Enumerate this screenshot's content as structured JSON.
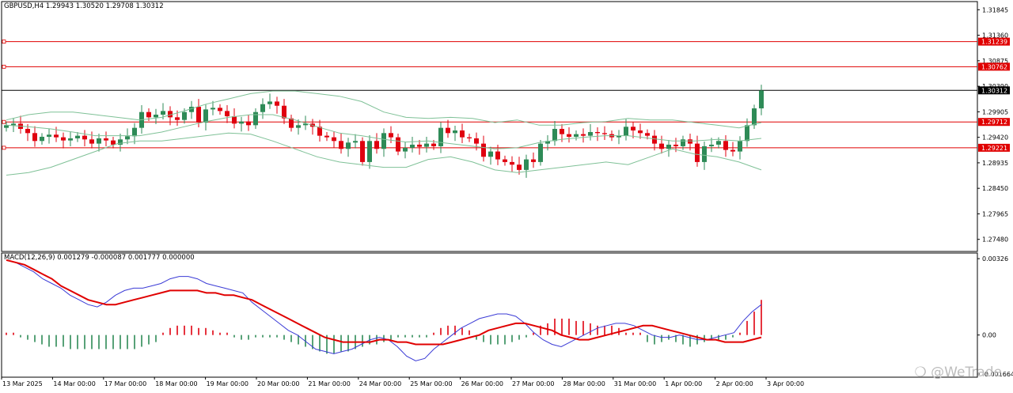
{
  "header": {
    "main_info": "GBPUSD,H4  1.29943 1.30520 1.29708 1.30312",
    "macd_info": "MACD(12,26,9) 0.001279 -0.000087 0.001777 0.000000"
  },
  "watermark": "@WeTrade",
  "colors": {
    "background": "#ffffff",
    "bull": "#2e8b57",
    "bear": "#e0000f",
    "band": "#7fc197",
    "hline": "#e00000",
    "macd_line": "#3b3bd6",
    "signal_line": "#e00000",
    "grid_border": "#000000"
  },
  "chart_data": [
    {
      "type": "candlestick",
      "symbol": "GBPUSD",
      "timeframe": "H4",
      "last_ohlc": {
        "open": 1.29943,
        "high": 1.3052,
        "low": 1.29708,
        "close": 1.30312
      },
      "price_axis_ticks": [
        "1.31845",
        "1.31360",
        "1.30875",
        "1.30390",
        "1.29905",
        "1.29420",
        "1.28935",
        "1.28450",
        "1.27965",
        "1.27480"
      ],
      "y_range": [
        1.2725,
        1.32
      ],
      "time_labels": [
        "13 Mar 2025",
        "14 Mar 00:00",
        "17 Mar 00:00",
        "18 Mar 00:00",
        "19 Mar 00:00",
        "20 Mar 00:00",
        "21 Mar 00:00",
        "24 Mar 00:00",
        "25 Mar 00:00",
        "26 Mar 00:00",
        "27 Mar 00:00",
        "28 Mar 00:00",
        "31 Mar 00:00",
        "1 Apr 00:00",
        "2 Apr 00:00",
        "3 Apr 00:00"
      ],
      "horizontal_levels": [
        {
          "value": 1.31239,
          "label": "1.31239",
          "color": "#e00000"
        },
        {
          "value": 1.30762,
          "label": "1.30762",
          "color": "#e00000"
        },
        {
          "value": 1.30312,
          "label": "1.30312",
          "color": "#000000"
        },
        {
          "value": 1.29712,
          "label": "1.29712",
          "color": "#e00000"
        },
        {
          "value": 1.29221,
          "label": "1.29221",
          "color": "#e00000"
        }
      ],
      "closes": [
        1.2965,
        1.2968,
        1.2958,
        1.295,
        1.2935,
        1.2943,
        1.2947,
        1.2942,
        1.2936,
        1.294,
        1.2945,
        1.2938,
        1.293,
        1.294,
        1.2936,
        1.2928,
        1.2938,
        1.2944,
        1.296,
        1.299,
        1.298,
        1.2985,
        1.2992,
        1.298,
        1.2975,
        1.299,
        1.3,
        1.297,
        1.2995,
        1.2998,
        1.2992,
        1.2982,
        1.2968,
        1.2972,
        1.2965,
        1.299,
        1.3005,
        1.301,
        1.3002,
        1.2978,
        1.296,
        1.2965,
        1.2968,
        1.2962,
        1.2945,
        1.2942,
        1.2935,
        1.292,
        1.2932,
        1.2935,
        1.2895,
        1.2935,
        1.292,
        1.295,
        1.2942,
        1.2915,
        1.2922,
        1.2928,
        1.2924,
        1.293,
        1.2925,
        1.296,
        1.295,
        1.2955,
        1.2942,
        1.294,
        1.293,
        1.2905,
        1.2915,
        1.29,
        1.2895,
        1.289,
        1.288,
        1.29,
        1.2895,
        1.293,
        1.2935,
        1.2958,
        1.2948,
        1.2943,
        1.2948,
        1.2945,
        1.2952,
        1.295,
        1.2948,
        1.2942,
        1.2945,
        1.2962,
        1.2955,
        1.295,
        1.2945,
        1.293,
        1.292,
        1.2928,
        1.2925,
        1.2938,
        1.293,
        1.2895,
        1.2925,
        1.2928,
        1.2935,
        1.2918,
        1.2915,
        1.2935,
        1.2965,
        1.2997,
        1.3031
      ],
      "bollinger_bands": {
        "upper": [
          1.2975,
          1.2985,
          1.299,
          1.299,
          1.2985,
          1.298,
          1.2975,
          1.298,
          1.2992,
          1.3005,
          1.3015,
          1.3025,
          1.303,
          1.303,
          1.3025,
          1.302,
          1.301,
          1.299,
          1.298,
          1.2978,
          1.298,
          1.2978,
          1.297,
          1.2975,
          1.2965,
          1.2965,
          1.297,
          1.2972,
          1.2978,
          1.2975,
          1.2975,
          1.297,
          1.2965,
          1.296,
          1.297
        ],
        "middle": [
          1.2965,
          1.2962,
          1.2958,
          1.2952,
          1.2945,
          1.2945,
          1.2945,
          1.2952,
          1.2962,
          1.2972,
          1.298,
          1.2985,
          1.2985,
          1.2975,
          1.2962,
          1.295,
          1.2945,
          1.2938,
          1.2933,
          1.2935,
          1.293,
          1.2925,
          1.292,
          1.2922,
          1.2932,
          1.2938,
          1.2942,
          1.2945,
          1.2945,
          1.294,
          1.2935,
          1.2935,
          1.2938,
          1.2935,
          1.294
        ],
        "lower": [
          1.287,
          1.2875,
          1.2885,
          1.29,
          1.2915,
          1.293,
          1.2935,
          1.2935,
          1.294,
          1.2945,
          1.295,
          1.2948,
          1.2935,
          1.292,
          1.2905,
          1.2895,
          1.289,
          1.2885,
          1.2885,
          1.29,
          1.2905,
          1.2895,
          1.288,
          1.2875,
          1.288,
          1.2885,
          1.289,
          1.2895,
          1.289,
          1.2905,
          1.292,
          1.291,
          1.2905,
          1.2895,
          1.288
        ]
      }
    },
    {
      "type": "macd",
      "params": "12,26,9",
      "values": {
        "macd": 0.001279,
        "signal": -8.7e-05,
        "histogram": 0.001777,
        "extra": 0.0
      },
      "y_axis_ticks": [
        "0.00326",
        "0.00",
        "-0.001664"
      ],
      "y_range": [
        -0.0018,
        0.0035
      ],
      "histogram": [
        0.0001,
        0.0001,
        -0.0001,
        -0.0002,
        -0.0003,
        -0.0004,
        -0.0005,
        -0.0005,
        -0.0005,
        -0.0006,
        -0.0006,
        -0.0006,
        -0.0006,
        -0.0006,
        -0.0006,
        -0.0006,
        -0.0006,
        -0.0006,
        -0.0006,
        -0.0005,
        -0.0004,
        -0.0003,
        0.0001,
        0.0003,
        0.0004,
        0.0004,
        0.0004,
        0.0003,
        0.0003,
        0.0002,
        0.0001,
        0.0001,
        -0.0001,
        -0.0002,
        -0.0002,
        -0.0001,
        -0.0001,
        -0.0001,
        -0.0001,
        -0.0002,
        -0.0003,
        -0.0004,
        -0.0005,
        -0.0006,
        -0.0007,
        -0.0008,
        -0.0008,
        -0.0007,
        -0.0007,
        -0.0006,
        -0.0005,
        -0.0004,
        -0.0004,
        -0.0003,
        -0.0002,
        -0.0001,
        -0.0001,
        -0.0001,
        -0.0001,
        -0.0001,
        0.0001,
        0.0003,
        0.0004,
        0.0004,
        0.0003,
        0.0002,
        -0.0002,
        -0.0003,
        -0.0004,
        -0.0004,
        -0.0004,
        -0.0003,
        -0.0002,
        -0.0001,
        0.0001,
        0.0004,
        0.0005,
        0.0007,
        0.0007,
        0.0007,
        0.0006,
        0.0006,
        0.0005,
        0.0004,
        0.0004,
        0.0004,
        0.0003,
        0.0001,
        0.0001,
        0.0001,
        -0.0003,
        -0.0004,
        -0.0003,
        -0.0002,
        -0.0003,
        -0.0004,
        -0.0005,
        -0.0004,
        -0.0003,
        -0.0002,
        -0.0002,
        -0.0002,
        -0.0001,
        0.0001,
        0.0006,
        0.001,
        0.0015
      ],
      "macd_line": [
        0.0032,
        0.0031,
        0.0029,
        0.0027,
        0.0024,
        0.0022,
        0.002,
        0.0017,
        0.0015,
        0.0013,
        0.0012,
        0.0014,
        0.0017,
        0.0019,
        0.002,
        0.002,
        0.0021,
        0.0022,
        0.0024,
        0.0025,
        0.0025,
        0.0024,
        0.0022,
        0.0021,
        0.002,
        0.0019,
        0.0018,
        0.0014,
        0.0011,
        0.0008,
        0.0005,
        0.0002,
        0.0,
        -0.0003,
        -0.0006,
        -0.0007,
        -0.0008,
        -0.0007,
        -0.0006,
        -0.0004,
        -0.0002,
        -0.0001,
        -0.0002,
        -0.0005,
        -0.0009,
        -0.0011,
        -0.001,
        -0.0006,
        -0.0003,
        0.0,
        0.0003,
        0.0005,
        0.0007,
        0.0008,
        0.0009,
        0.0009,
        0.0008,
        0.0005,
        0.0001,
        -0.0002,
        -0.0004,
        -0.0005,
        -0.0003,
        -0.0001,
        0.0001,
        0.0003,
        0.0004,
        0.0005,
        0.0005,
        0.0004,
        0.0002,
        0.0,
        -0.0001,
        -0.0001,
        0.0,
        -0.0001,
        -0.0002,
        -0.0002,
        -0.0001,
        0.0,
        0.0001,
        0.0006,
        0.001,
        0.0013
      ],
      "signal_line": [
        0.0032,
        0.0031,
        0.003,
        0.0028,
        0.0026,
        0.0024,
        0.0021,
        0.0019,
        0.0017,
        0.0015,
        0.0014,
        0.0013,
        0.0013,
        0.0014,
        0.0015,
        0.0016,
        0.0017,
        0.0018,
        0.0019,
        0.0019,
        0.0019,
        0.0019,
        0.0018,
        0.0018,
        0.0017,
        0.0017,
        0.0016,
        0.0015,
        0.0013,
        0.0011,
        0.0009,
        0.0007,
        0.0005,
        0.0003,
        0.0001,
        -0.0001,
        -0.0002,
        -0.0003,
        -0.0003,
        -0.0003,
        -0.0003,
        -0.0002,
        -0.0002,
        -0.0003,
        -0.0003,
        -0.0004,
        -0.0004,
        -0.0004,
        -0.0004,
        -0.0003,
        -0.0002,
        -0.0001,
        0.0,
        0.0002,
        0.0003,
        0.0004,
        0.0005,
        0.0005,
        0.0004,
        0.0003,
        0.0002,
        0.0,
        -0.0001,
        -0.0002,
        -0.0002,
        -0.0001,
        0.0,
        0.0001,
        0.0002,
        0.0003,
        0.0004,
        0.0004,
        0.0003,
        0.0002,
        0.0001,
        0.0,
        -0.0001,
        -0.0002,
        -0.0002,
        -0.0003,
        -0.0003,
        -0.0003,
        -0.0002,
        -0.0001
      ]
    }
  ]
}
